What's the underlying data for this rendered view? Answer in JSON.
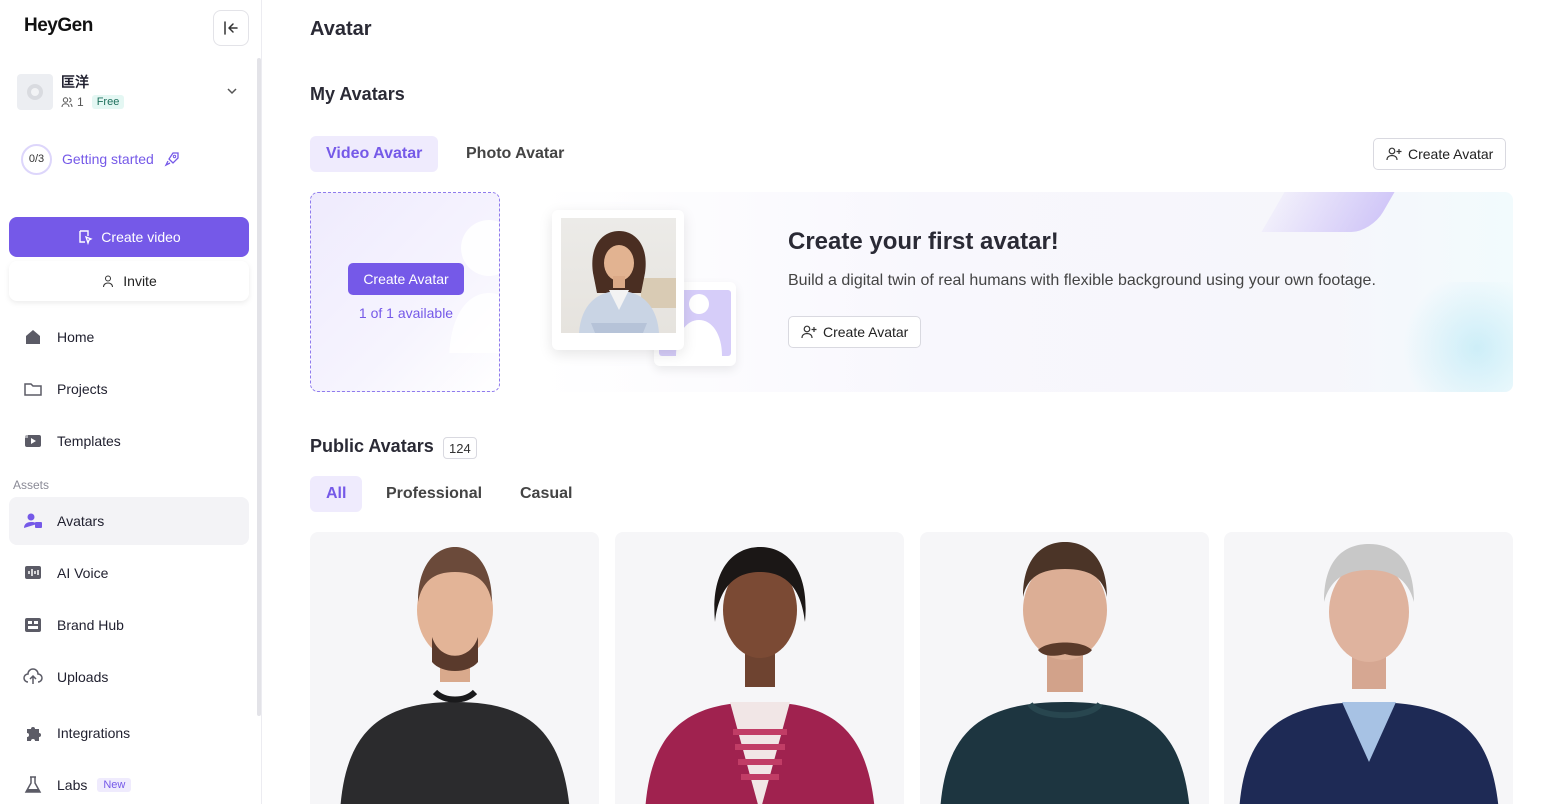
{
  "sidebar": {
    "logo": "HeyGen",
    "workspace": {
      "name": "匡洋",
      "members": "1",
      "plan": "Free"
    },
    "getting_started": {
      "progress": "0/3",
      "label": "Getting started"
    },
    "create_video": "Create video",
    "invite": "Invite",
    "nav": [
      {
        "label": "Home",
        "icon": "home-icon"
      },
      {
        "label": "Projects",
        "icon": "folder-icon"
      },
      {
        "label": "Templates",
        "icon": "templates-icon"
      }
    ],
    "assets_label": "Assets",
    "assets": [
      {
        "label": "Avatars",
        "icon": "avatar-icon",
        "active": true
      },
      {
        "label": "AI Voice",
        "icon": "voice-icon"
      },
      {
        "label": "Brand Hub",
        "icon": "brand-icon"
      },
      {
        "label": "Uploads",
        "icon": "upload-icon"
      },
      {
        "label": "Integrations",
        "icon": "puzzle-icon"
      },
      {
        "label": "Labs",
        "icon": "flask-icon",
        "badge": "New"
      }
    ]
  },
  "main": {
    "title": "Avatar",
    "my_avatars": {
      "title": "My Avatars",
      "tabs": [
        "Video Avatar",
        "Photo Avatar"
      ],
      "active_tab": "Video Avatar",
      "create_button": "Create Avatar",
      "card": {
        "button": "Create Avatar",
        "availability": "1 of 1 available"
      },
      "banner": {
        "title": "Create your first avatar!",
        "text": "Build a digital twin of real humans with flexible background using your own footage.",
        "button": "Create Avatar"
      }
    },
    "public_avatars": {
      "title": "Public Avatars",
      "count": "124",
      "filters": [
        "All",
        "Professional",
        "Casual"
      ],
      "active_filter": "All"
    }
  },
  "colors": {
    "accent": "#7559e8",
    "accent_light": "#efebfd",
    "free_badge": "#e4f7f3"
  }
}
